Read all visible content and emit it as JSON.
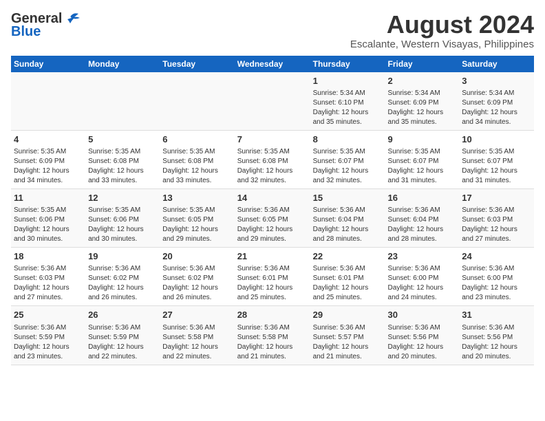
{
  "logo": {
    "line1": "General",
    "line2": "Blue"
  },
  "title": "August 2024",
  "subtitle": "Escalante, Western Visayas, Philippines",
  "weekdays": [
    "Sunday",
    "Monday",
    "Tuesday",
    "Wednesday",
    "Thursday",
    "Friday",
    "Saturday"
  ],
  "weeks": [
    [
      {
        "day": "",
        "text": ""
      },
      {
        "day": "",
        "text": ""
      },
      {
        "day": "",
        "text": ""
      },
      {
        "day": "",
        "text": ""
      },
      {
        "day": "1",
        "text": "Sunrise: 5:34 AM\nSunset: 6:10 PM\nDaylight: 12 hours\nand 35 minutes."
      },
      {
        "day": "2",
        "text": "Sunrise: 5:34 AM\nSunset: 6:09 PM\nDaylight: 12 hours\nand 35 minutes."
      },
      {
        "day": "3",
        "text": "Sunrise: 5:34 AM\nSunset: 6:09 PM\nDaylight: 12 hours\nand 34 minutes."
      }
    ],
    [
      {
        "day": "4",
        "text": "Sunrise: 5:35 AM\nSunset: 6:09 PM\nDaylight: 12 hours\nand 34 minutes."
      },
      {
        "day": "5",
        "text": "Sunrise: 5:35 AM\nSunset: 6:08 PM\nDaylight: 12 hours\nand 33 minutes."
      },
      {
        "day": "6",
        "text": "Sunrise: 5:35 AM\nSunset: 6:08 PM\nDaylight: 12 hours\nand 33 minutes."
      },
      {
        "day": "7",
        "text": "Sunrise: 5:35 AM\nSunset: 6:08 PM\nDaylight: 12 hours\nand 32 minutes."
      },
      {
        "day": "8",
        "text": "Sunrise: 5:35 AM\nSunset: 6:07 PM\nDaylight: 12 hours\nand 32 minutes."
      },
      {
        "day": "9",
        "text": "Sunrise: 5:35 AM\nSunset: 6:07 PM\nDaylight: 12 hours\nand 31 minutes."
      },
      {
        "day": "10",
        "text": "Sunrise: 5:35 AM\nSunset: 6:07 PM\nDaylight: 12 hours\nand 31 minutes."
      }
    ],
    [
      {
        "day": "11",
        "text": "Sunrise: 5:35 AM\nSunset: 6:06 PM\nDaylight: 12 hours\nand 30 minutes."
      },
      {
        "day": "12",
        "text": "Sunrise: 5:35 AM\nSunset: 6:06 PM\nDaylight: 12 hours\nand 30 minutes."
      },
      {
        "day": "13",
        "text": "Sunrise: 5:35 AM\nSunset: 6:05 PM\nDaylight: 12 hours\nand 29 minutes."
      },
      {
        "day": "14",
        "text": "Sunrise: 5:36 AM\nSunset: 6:05 PM\nDaylight: 12 hours\nand 29 minutes."
      },
      {
        "day": "15",
        "text": "Sunrise: 5:36 AM\nSunset: 6:04 PM\nDaylight: 12 hours\nand 28 minutes."
      },
      {
        "day": "16",
        "text": "Sunrise: 5:36 AM\nSunset: 6:04 PM\nDaylight: 12 hours\nand 28 minutes."
      },
      {
        "day": "17",
        "text": "Sunrise: 5:36 AM\nSunset: 6:03 PM\nDaylight: 12 hours\nand 27 minutes."
      }
    ],
    [
      {
        "day": "18",
        "text": "Sunrise: 5:36 AM\nSunset: 6:03 PM\nDaylight: 12 hours\nand 27 minutes."
      },
      {
        "day": "19",
        "text": "Sunrise: 5:36 AM\nSunset: 6:02 PM\nDaylight: 12 hours\nand 26 minutes."
      },
      {
        "day": "20",
        "text": "Sunrise: 5:36 AM\nSunset: 6:02 PM\nDaylight: 12 hours\nand 26 minutes."
      },
      {
        "day": "21",
        "text": "Sunrise: 5:36 AM\nSunset: 6:01 PM\nDaylight: 12 hours\nand 25 minutes."
      },
      {
        "day": "22",
        "text": "Sunrise: 5:36 AM\nSunset: 6:01 PM\nDaylight: 12 hours\nand 25 minutes."
      },
      {
        "day": "23",
        "text": "Sunrise: 5:36 AM\nSunset: 6:00 PM\nDaylight: 12 hours\nand 24 minutes."
      },
      {
        "day": "24",
        "text": "Sunrise: 5:36 AM\nSunset: 6:00 PM\nDaylight: 12 hours\nand 23 minutes."
      }
    ],
    [
      {
        "day": "25",
        "text": "Sunrise: 5:36 AM\nSunset: 5:59 PM\nDaylight: 12 hours\nand 23 minutes."
      },
      {
        "day": "26",
        "text": "Sunrise: 5:36 AM\nSunset: 5:59 PM\nDaylight: 12 hours\nand 22 minutes."
      },
      {
        "day": "27",
        "text": "Sunrise: 5:36 AM\nSunset: 5:58 PM\nDaylight: 12 hours\nand 22 minutes."
      },
      {
        "day": "28",
        "text": "Sunrise: 5:36 AM\nSunset: 5:58 PM\nDaylight: 12 hours\nand 21 minutes."
      },
      {
        "day": "29",
        "text": "Sunrise: 5:36 AM\nSunset: 5:57 PM\nDaylight: 12 hours\nand 21 minutes."
      },
      {
        "day": "30",
        "text": "Sunrise: 5:36 AM\nSunset: 5:56 PM\nDaylight: 12 hours\nand 20 minutes."
      },
      {
        "day": "31",
        "text": "Sunrise: 5:36 AM\nSunset: 5:56 PM\nDaylight: 12 hours\nand 20 minutes."
      }
    ]
  ]
}
